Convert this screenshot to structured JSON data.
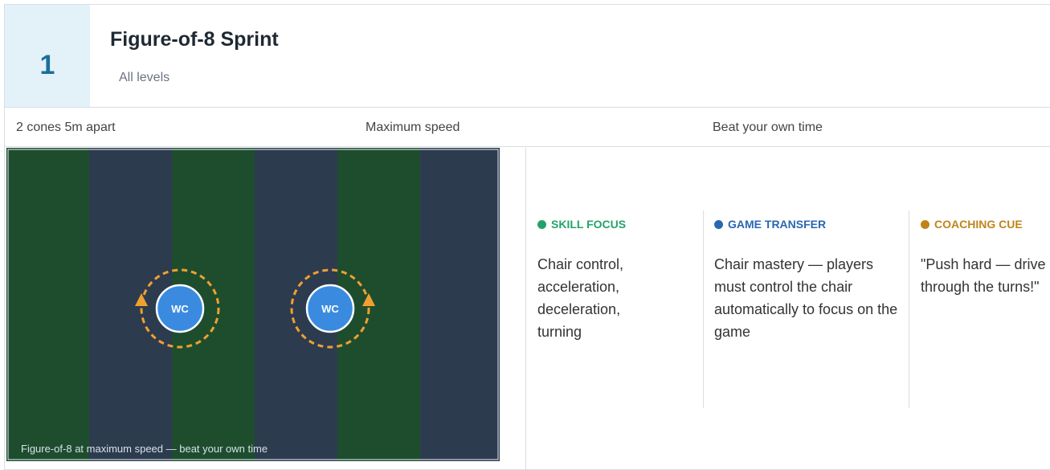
{
  "drill": {
    "number": "1",
    "title": "Figure-of-8 Sprint",
    "level": "All levels"
  },
  "meta": {
    "equipment": "2 cones 5m apart",
    "intensity": "Maximum speed",
    "challenge": "Beat your own time"
  },
  "diagram": {
    "player_label_1": "WC",
    "player_label_2": "WC",
    "caption": "Figure-of-8 at maximum speed — beat your own time",
    "colors": {
      "stripe_green": "#1e4d2e",
      "stripe_navy": "#2d3b4e",
      "player": "#3a8be0",
      "path": "#f0a030"
    }
  },
  "columns": [
    {
      "heading": "SKILL FOCUS",
      "color": "#23a36b",
      "text": "Chair control, acceleration, deceleration, turning"
    },
    {
      "heading": "GAME TRANSFER",
      "color": "#2a67b0",
      "text": "Chair mastery — players must control the chair automatically to focus on the game"
    },
    {
      "heading": "COACHING CUE",
      "color": "#c0841c",
      "text": "\"Push hard — drive through the turns!\""
    }
  ]
}
